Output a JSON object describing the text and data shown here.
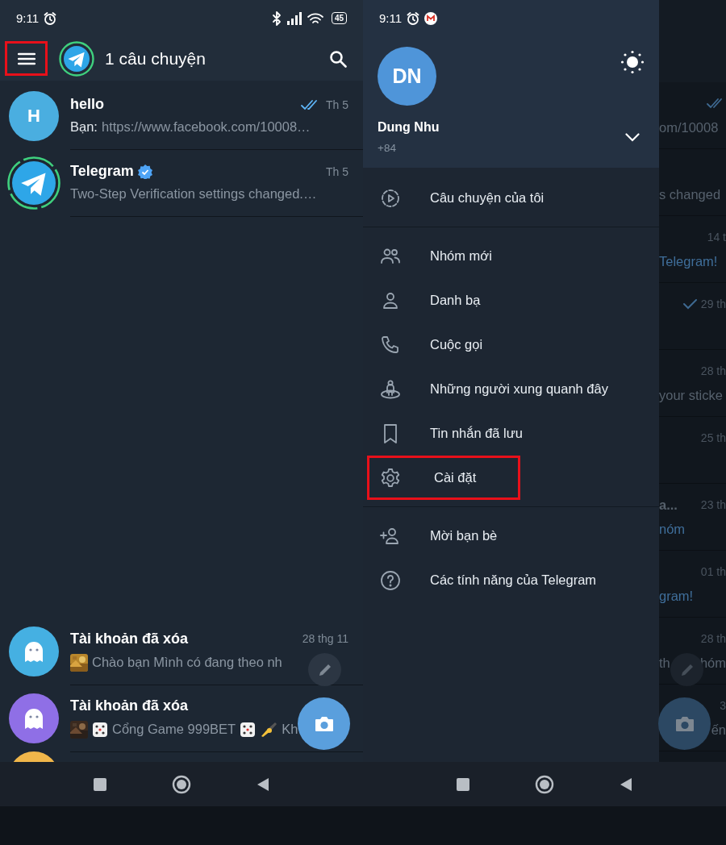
{
  "left_screen": {
    "status_bar": {
      "time": "9:11",
      "battery": "45"
    },
    "header": {
      "title": "1 câu chuyện",
      "menu_highlighted": true
    },
    "chats_top": [
      {
        "kind": "letter",
        "initial": "H",
        "color": "#4aaee0",
        "name": "hello",
        "verified": false,
        "read": true,
        "time": "Th 5",
        "sender": "Bạn:",
        "preview": [
          {
            "kind": "text",
            "text": "https://www.facebook.com/10008…"
          }
        ]
      },
      {
        "kind": "telegram",
        "story_ring": true,
        "name": "Telegram",
        "verified": true,
        "read": false,
        "time": "Th 5",
        "preview": [
          {
            "kind": "text",
            "text": "Two-Step Verification settings changed.…"
          }
        ]
      }
    ],
    "chats_bottom": [
      {
        "kind": "ghost",
        "color": "#45b0e2",
        "name": "Tài khoản đã xóa",
        "verified": false,
        "read": false,
        "time": "28 thg 11",
        "preview": [
          {
            "kind": "picture"
          },
          {
            "kind": "text",
            "text": "Chào bạn  Mình có đang theo nh"
          }
        ]
      },
      {
        "kind": "ghost",
        "color": "#8f6fe6",
        "name": "Tài khoản đã xóa",
        "verified": false,
        "read": false,
        "preview": [
          {
            "kind": "picture"
          },
          {
            "kind": "die"
          },
          {
            "kind": "text",
            "text": "Cổng Game 999BET"
          },
          {
            "kind": "die"
          },
          {
            "kind": "hand"
          },
          {
            "kind": "text",
            "text": "Kh"
          }
        ]
      },
      {
        "kind": "cut_off",
        "color": "#f0b64a"
      }
    ]
  },
  "right_screen": {
    "status_bar": {
      "time": "9:11"
    },
    "profile": {
      "initials": "DN",
      "name": "Dung Nhu",
      "phone": "+84",
      "accounts_expanded": false
    },
    "drawer": {
      "items": [
        {
          "kind": "story",
          "label": "Câu chuyện của tôi",
          "highlighted": false,
          "divider_after": true
        },
        {
          "kind": "group",
          "label": "Nhóm mới",
          "highlighted": false,
          "divider_after": false
        },
        {
          "kind": "person",
          "label": "Danh bạ",
          "highlighted": false,
          "divider_after": false
        },
        {
          "kind": "phone",
          "label": "Cuộc gọi",
          "highlighted": false,
          "divider_after": false
        },
        {
          "kind": "nearby",
          "label": "Những người xung quanh đây",
          "highlighted": false,
          "divider_after": false
        },
        {
          "kind": "bookmark",
          "label": "Tin nhắn đã lưu",
          "highlighted": false,
          "divider_after": false
        },
        {
          "kind": "gear",
          "label": "Cài đặt",
          "highlighted": true,
          "divider_after": true
        },
        {
          "kind": "add_person",
          "label": "Mời bạn bè",
          "highlighted": false,
          "divider_after": false
        },
        {
          "kind": "help",
          "label": "Các tính năng của Telegram",
          "highlighted": false,
          "divider_after": false
        }
      ]
    },
    "dimmed_chats": [
      {
        "kind": "double_check",
        "preview": "om/10008"
      },
      {
        "kind": "plain",
        "preview": "s changed"
      },
      {
        "kind": "plain",
        "time": "14 t",
        "preview": "Telegram!",
        "color": "#3f6e9a"
      },
      {
        "kind": "single_check",
        "time": "29 th"
      },
      {
        "kind": "plain",
        "time": "28 th",
        "preview": "your sticke"
      },
      {
        "kind": "plain",
        "time": "25 th"
      },
      {
        "kind": "plain",
        "name": "a...",
        "time": "23 th",
        "preview": "nóm",
        "color": "#3f6e9a"
      },
      {
        "kind": "plain",
        "time": "01 th",
        "preview": "gram!",
        "color": "#3f6e9a"
      },
      {
        "kind": "plain",
        "time": "28 th",
        "preview": "th",
        "preview_end": "hóm"
      },
      {
        "kind": "plain",
        "time": "3",
        "preview_end": "ến"
      }
    ]
  }
}
